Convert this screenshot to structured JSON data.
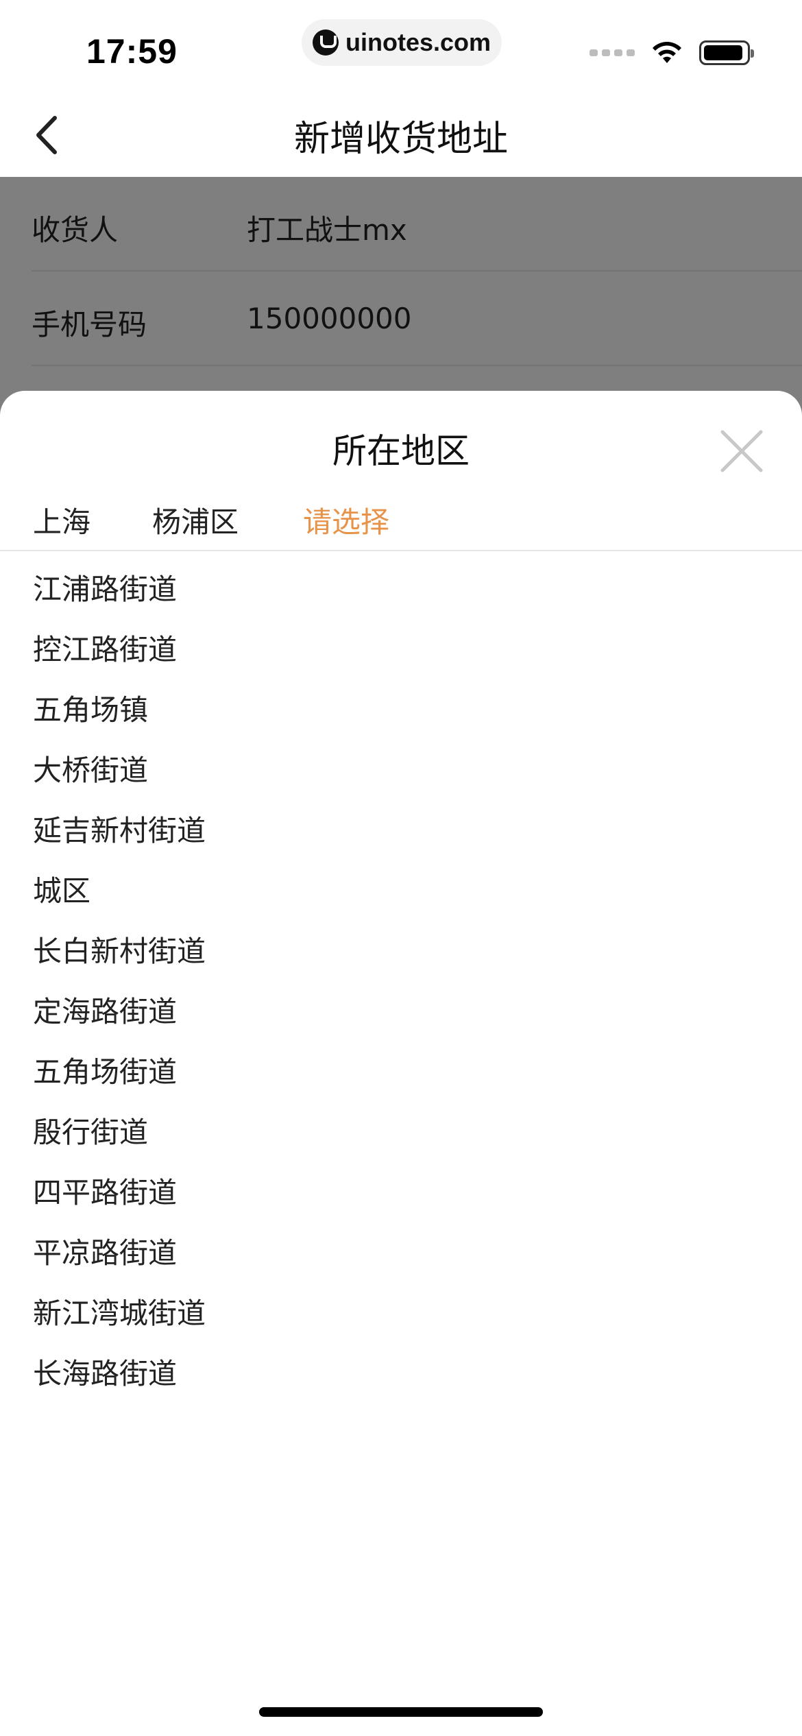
{
  "status_bar": {
    "time": "17:59",
    "url": "uinotes.com"
  },
  "nav": {
    "title": "新增收货地址"
  },
  "form": {
    "fields": [
      {
        "label": "收货人",
        "value": "打工战士mx"
      },
      {
        "label": "手机号码",
        "value": "150000000"
      }
    ]
  },
  "sheet": {
    "title": "所在地区",
    "tabs": [
      {
        "label": "上海",
        "active": false
      },
      {
        "label": "杨浦区",
        "active": false
      },
      {
        "label": "请选择",
        "active": true
      }
    ],
    "options": [
      "江浦路街道",
      "控江路街道",
      "五角场镇",
      "大桥街道",
      "延吉新村街道",
      "城区",
      "长白新村街道",
      "定海路街道",
      "五角场街道",
      "殷行街道",
      "四平路街道",
      "平凉路街道",
      "新江湾城街道",
      "长海路街道"
    ],
    "accent_color": "#e8934a"
  }
}
